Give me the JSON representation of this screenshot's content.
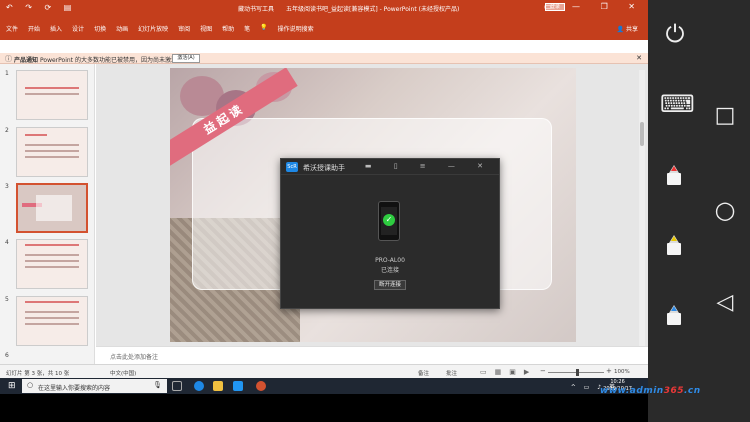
{
  "app": {
    "quick_access": "↶ ↷ ⟳ ▤",
    "context_tab": "藏动书写工具",
    "doc_title": "五年级阅读书吧_益起读[兼容模式] - PowerPoint (未经授权产品)",
    "login_label": "登录",
    "window_controls": "▭ — ❐ ✕"
  },
  "ribbon": {
    "tabs": [
      "文件",
      "开始",
      "插入",
      "设计",
      "切换",
      "动画",
      "幻灯片放映",
      "审阅",
      "视图",
      "帮助",
      "笔"
    ],
    "tell_me": "操作说明搜索",
    "share": "共享"
  },
  "infobar": {
    "label": "产品通知",
    "message": "PowerPoint 的大多数功能已被禁用，因为尚未激活。",
    "button": "激活(A)",
    "close": "✕"
  },
  "thumbnails": {
    "numbers": [
      "1",
      "2",
      "3",
      "4",
      "5",
      "6"
    ],
    "selected_index": 3
  },
  "slide": {
    "ribbon_text": "益起读"
  },
  "notes": {
    "placeholder": "点击此处添加备注"
  },
  "status": {
    "slide_info": "幻灯片 第 3 张，共 10 张",
    "language": "中文(中国)",
    "notes_btn": "备注",
    "comments_btn": "批注",
    "zoom": "100%"
  },
  "taskbar": {
    "search_placeholder": "在这里输入你要搜索的内容",
    "tray": "^ ▭ ♪ 英",
    "time": "10:26",
    "date": "2019/10/17"
  },
  "dialog": {
    "logo": "ScR",
    "title": "希沃授课助手",
    "controls": "▬ ▯ ≡ — ✕",
    "device_name": "PRO-AL00",
    "device_status": "已连接",
    "disconnect_button": "断开连接"
  },
  "android_nav": {
    "power_icon": "⏻",
    "keyboard_icon": "⌨",
    "square_icon": "□",
    "circle_icon": "○",
    "back_icon": "◁"
  },
  "watermark": {
    "prefix": "www.",
    "brand": "admin",
    "num": "365",
    "suffix": ".cn"
  },
  "colors": {
    "ribbon_red": "#c43e1c",
    "accent_pink": "#e06c7e",
    "dialog_bg": "#2b2b2b",
    "nav_bg": "#2a2a2a"
  }
}
